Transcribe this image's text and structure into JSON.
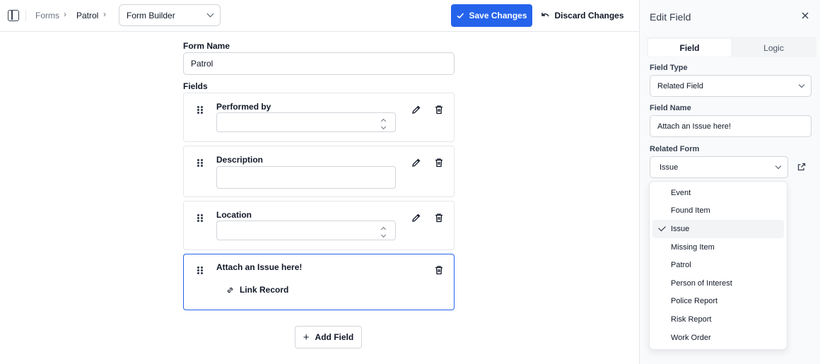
{
  "header": {
    "breadcrumb": [
      "Forms",
      "Patrol"
    ],
    "view_select": "Form Builder",
    "save_label": "Save Changes",
    "discard_label": "Discard Changes"
  },
  "form": {
    "name_label": "Form Name",
    "name_value": "Patrol",
    "fields_label": "Fields",
    "fields": [
      {
        "label": "Performed by",
        "type": "select"
      },
      {
        "label": "Description",
        "type": "text"
      },
      {
        "label": "Location",
        "type": "select"
      },
      {
        "label": "Attach an Issue here!",
        "type": "related",
        "action": "Link Record"
      }
    ],
    "add_field_label": "Add Field"
  },
  "panel": {
    "title": "Edit Field",
    "tabs": [
      "Field",
      "Logic"
    ],
    "active_tab": "Field",
    "field_type_label": "Field Type",
    "field_type_value": "Related Field",
    "field_name_label": "Field Name",
    "field_name_value": "Attach an Issue here!",
    "related_form_label": "Related Form",
    "related_form_value": "Issue",
    "options": [
      "Event",
      "Found Item",
      "Issue",
      "Missing Item",
      "Patrol",
      "Person of Interest",
      "Police Report",
      "Risk Report",
      "Work Order"
    ],
    "selected_option": "Issue"
  },
  "colors": {
    "primary": "#2563eb",
    "border": "#d1d5db"
  }
}
